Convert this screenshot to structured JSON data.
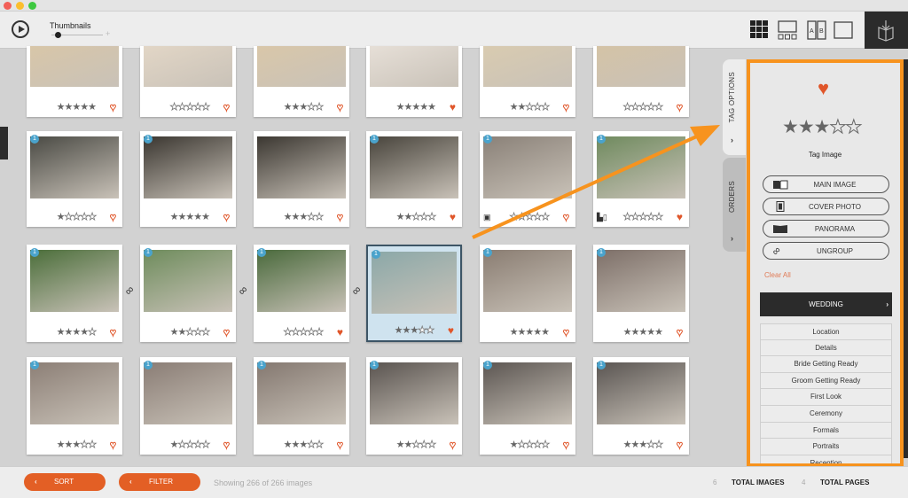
{
  "window": {
    "traffic_lights": [
      "#f25f58",
      "#fbbe2e",
      "#3ec840"
    ]
  },
  "toolbar": {
    "play_icon": "play-icon",
    "thumbnails_label": "Thumbnails",
    "zoom_slider_value": 0.1,
    "view_modes": [
      "grid-view-icon",
      "filmstrip-view-icon",
      "compare-view-icon",
      "single-view-icon"
    ],
    "book_button_icon": "book-icon"
  },
  "grid": {
    "rows": [
      [
        {
          "badge": "",
          "rating": 5,
          "favorite": false,
          "tag": ""
        },
        {
          "badge": "",
          "rating": 0,
          "favorite": false,
          "tag": ""
        },
        {
          "badge": "",
          "rating": 3,
          "favorite": false,
          "tag": ""
        },
        {
          "badge": "",
          "rating": 5,
          "favorite": true,
          "tag": ""
        },
        {
          "badge": "",
          "rating": 2,
          "favorite": false,
          "tag": ""
        },
        {
          "badge": "",
          "rating": 0,
          "favorite": false,
          "tag": ""
        }
      ],
      [
        {
          "badge": "1",
          "rating": 1,
          "favorite": false,
          "tag": ""
        },
        {
          "badge": "1",
          "rating": 5,
          "favorite": false,
          "tag": ""
        },
        {
          "badge": "",
          "rating": 3,
          "favorite": false,
          "tag": ""
        },
        {
          "badge": "1",
          "rating": 2,
          "favorite": true,
          "tag": ""
        },
        {
          "badge": "1",
          "rating": 0,
          "favorite": false,
          "tag": "cover-photo"
        },
        {
          "badge": "1",
          "rating": 0,
          "favorite": true,
          "tag": "main-image"
        }
      ],
      [
        {
          "badge": "1",
          "rating": 4,
          "favorite": false,
          "tag": "",
          "linked_next": true
        },
        {
          "badge": "1",
          "rating": 2,
          "favorite": false,
          "tag": "",
          "linked_next": true
        },
        {
          "badge": "1",
          "rating": 0,
          "favorite": true,
          "tag": "",
          "linked_next": true
        },
        {
          "badge": "1",
          "rating": 3,
          "favorite": true,
          "tag": "",
          "selected": true
        },
        {
          "badge": "1",
          "rating": 5,
          "favorite": false,
          "tag": ""
        },
        {
          "badge": "1",
          "rating": 5,
          "favorite": false,
          "tag": ""
        }
      ],
      [
        {
          "badge": "1",
          "rating": 3,
          "favorite": false,
          "tag": ""
        },
        {
          "badge": "1",
          "rating": 1,
          "favorite": false,
          "tag": ""
        },
        {
          "badge": "1",
          "rating": 3,
          "favorite": false,
          "tag": ""
        },
        {
          "badge": "1",
          "rating": 2,
          "favorite": false,
          "tag": ""
        },
        {
          "badge": "1",
          "rating": 1,
          "favorite": false,
          "tag": ""
        },
        {
          "badge": "1",
          "rating": 3,
          "favorite": false,
          "tag": ""
        }
      ]
    ]
  },
  "side_tabs": [
    {
      "label": "TAG OPTIONS",
      "chevron": "›"
    },
    {
      "label": "ORDERS",
      "chevron": "›"
    }
  ],
  "tag_panel": {
    "favorite": true,
    "rating": 3,
    "max_rating": 5,
    "title": "Tag Image",
    "buttons": [
      {
        "icon": "main-image-icon",
        "label": "MAIN IMAGE"
      },
      {
        "icon": "cover-photo-icon",
        "label": "COVER PHOTO"
      },
      {
        "icon": "panorama-icon",
        "label": "PANORAMA"
      },
      {
        "icon": "link-icon",
        "label": "UNGROUP"
      }
    ],
    "clear_all": "Clear All",
    "category_header": "WEDDING",
    "category_chevron": "›",
    "categories": [
      "Location",
      "Details",
      "Bride Getting Ready",
      "Groom Getting Ready",
      "First Look",
      "Ceremony",
      "Formals",
      "Portraits",
      "Reception"
    ],
    "accent_color": "#f7931e"
  },
  "footer": {
    "sort_label": "SORT",
    "filter_label": "FILTER",
    "chevron": "‹",
    "showing_text": "Showing 266 of 266 images",
    "total_images_count": "6",
    "total_images_label": "TOTAL IMAGES",
    "total_pages_count": "4",
    "total_pages_label": "TOTAL PAGES",
    "button_color": "#e35f25"
  }
}
